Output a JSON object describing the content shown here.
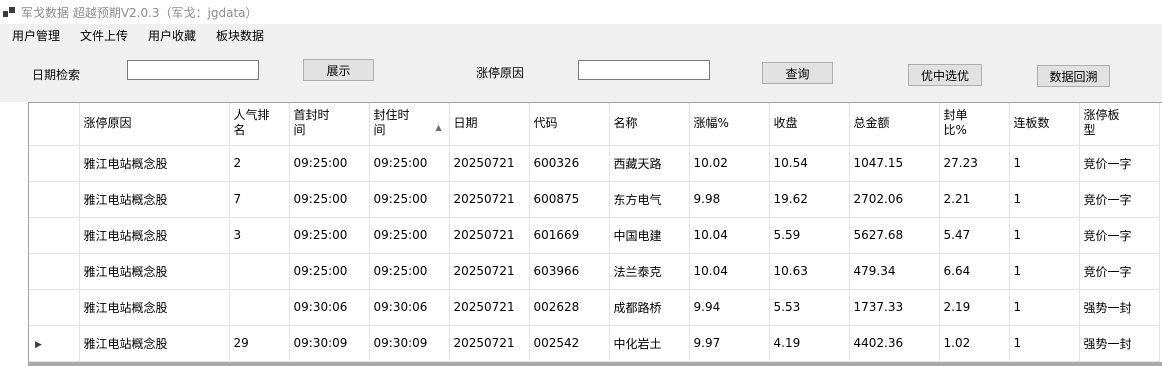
{
  "window": {
    "title": "军戈数据 超越预期V2.0.3（军戈：jgdata）"
  },
  "menu": [
    "用户管理",
    "文件上传",
    "用户收藏",
    "板块数据"
  ],
  "toolbar": {
    "date_label": "日期检索",
    "date_value": "",
    "show_button": "展示",
    "reason_label": "涨停原因",
    "reason_value": "",
    "query_button": "查询",
    "pick_button": "优中选优",
    "backtrack_button": "数据回溯"
  },
  "grid": {
    "columns": [
      "涨停原因",
      "人气排名",
      "首封时间",
      "封住时间",
      "日期",
      "代码",
      "名称",
      "涨幅%",
      "收盘",
      "总金额",
      "封单比%",
      "连板数",
      "涨停板型"
    ],
    "sorted_column": "封住时间",
    "sort_direction": "ascending",
    "current_row_marker": "▶",
    "rows": [
      [
        "雅江电站概念股",
        "2",
        "09:25:00",
        "09:25:00",
        "20250721",
        "600326",
        "西藏天路",
        "10.02",
        "10.54",
        "1047.15",
        "27.23",
        "1",
        "竞价一字"
      ],
      [
        "雅江电站概念股",
        "7",
        "09:25:00",
        "09:25:00",
        "20250721",
        "600875",
        "东方电气",
        "9.98",
        "19.62",
        "2702.06",
        "2.21",
        "1",
        "竞价一字"
      ],
      [
        "雅江电站概念股",
        "3",
        "09:25:00",
        "09:25:00",
        "20250721",
        "601669",
        "中国电建",
        "10.04",
        "5.59",
        "5627.68",
        "5.47",
        "1",
        "竞价一字"
      ],
      [
        "雅江电站概念股",
        "",
        "09:25:00",
        "09:25:00",
        "20250721",
        "603966",
        "法兰泰克",
        "10.04",
        "10.63",
        "479.34",
        "6.64",
        "1",
        "竞价一字"
      ],
      [
        "雅江电站概念股",
        "",
        "09:30:06",
        "09:30:06",
        "20250721",
        "002628",
        "成都路桥",
        "9.94",
        "5.53",
        "1737.33",
        "2.19",
        "1",
        "强势一封"
      ],
      [
        "雅江电站概念股",
        "29",
        "09:30:09",
        "09:30:09",
        "20250721",
        "002542",
        "中化岩土",
        "9.97",
        "4.19",
        "4402.36",
        "1.02",
        "1",
        "强势一封"
      ]
    ]
  }
}
